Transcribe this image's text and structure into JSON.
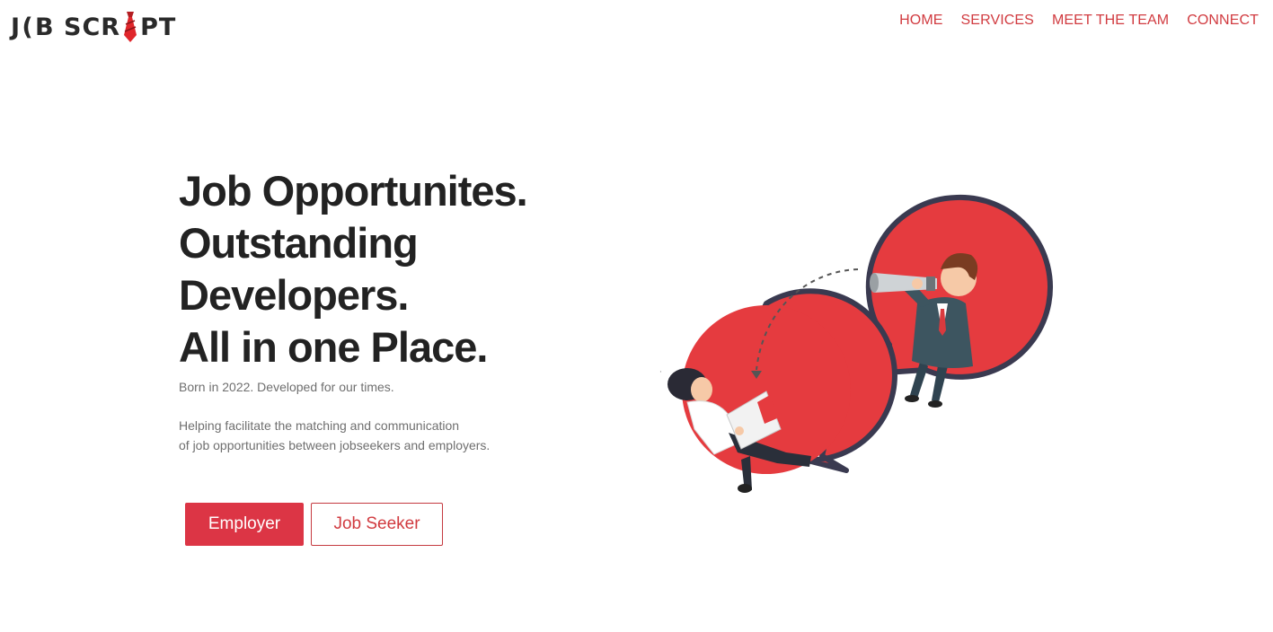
{
  "header": {
    "logo_text_left": "J",
    "logo_text_mid": "B SCR",
    "logo_text_right": "PT",
    "nav": [
      {
        "label": "HOME"
      },
      {
        "label": "SERVICES"
      },
      {
        "label": "MEET THE TEAM"
      },
      {
        "label": "CONNECT"
      }
    ]
  },
  "hero": {
    "headline": [
      "Job Opportunites.",
      "Outstanding",
      "Developers.",
      "All in one Place."
    ],
    "tagline": "Born in 2022. Developed for our times.",
    "description": [
      "Helping facilitate the matching and communication",
      "of job opportunities between jobseekers and employers."
    ],
    "buttons": {
      "employer": "Employer",
      "job_seeker": "Job Seeker"
    }
  },
  "colors": {
    "accent": "#dc3545",
    "nav_text": "#d13b40",
    "heading": "#222222",
    "body_text": "#6f6f6f",
    "bubble_red": "#e53b3f",
    "bubble_outline": "#3a3a50"
  },
  "illustration": {
    "subject": "two people in red speech bubbles, one with telescope, one with laptop"
  }
}
